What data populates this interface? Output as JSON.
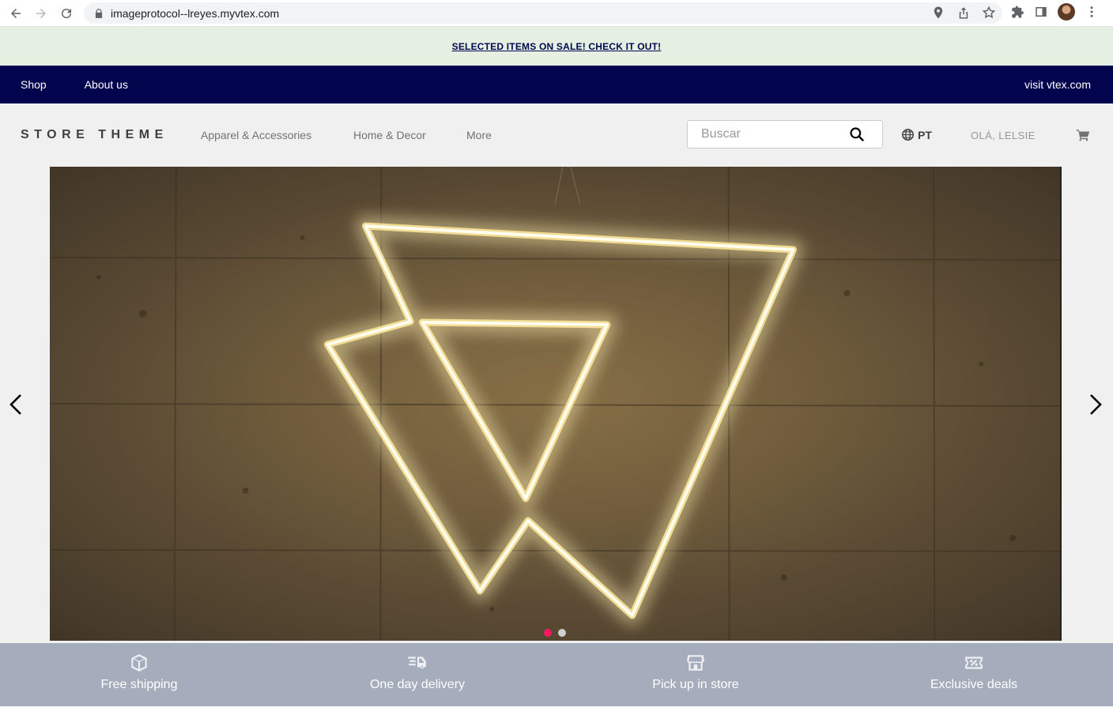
{
  "browser": {
    "url": "imageprotocol--lreyes.myvtex.com"
  },
  "promo": {
    "text": "SELECTED ITEMS ON SALE! CHECK IT OUT!"
  },
  "topnav": {
    "items": [
      "Shop",
      "About us"
    ],
    "right_link": "visit vtex.com"
  },
  "header": {
    "logo": "STORE THEME",
    "menu": [
      "Apparel & Accessories",
      "Home & Decor",
      "More"
    ],
    "search_placeholder": "Buscar",
    "language": "PT",
    "greeting": "OLÁ, LELSIE"
  },
  "hero": {
    "slide_count": 2,
    "active_slide": 1,
    "colors": {
      "active_dot": "#f71963",
      "inactive_dot": "#cfd0d1"
    }
  },
  "features": [
    {
      "label": "Free shipping",
      "icon": "box-icon"
    },
    {
      "label": "One day delivery",
      "icon": "fast-truck-icon"
    },
    {
      "label": "Pick up in store",
      "icon": "store-icon"
    },
    {
      "label": "Exclusive deals",
      "icon": "ticket-icon"
    }
  ],
  "colors": {
    "promo_bg": "#e5f0e3",
    "topnav_bg": "#03044e",
    "features_bg": "#a5acbb"
  }
}
